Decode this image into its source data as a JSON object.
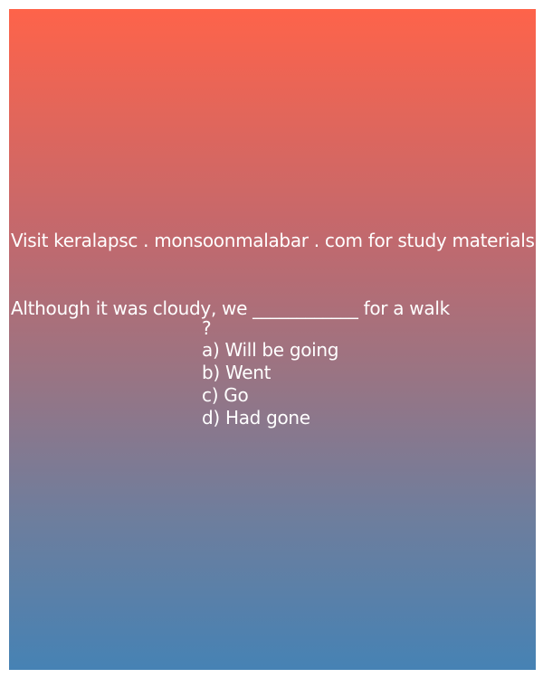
{
  "promo": {
    "text": "Visit keralapsc . monsoonmalabar . com for study materials"
  },
  "question": {
    "line1": "Although it was cloudy, we ____________ for a walk",
    "line2": "?"
  },
  "options": [
    "a) Will be going",
    "b) Went",
    "c) Go",
    "d) Had gone"
  ],
  "colors": {
    "gradient_top": "#fe634a",
    "gradient_bottom": "#4682b4",
    "text": "#ffffff"
  }
}
